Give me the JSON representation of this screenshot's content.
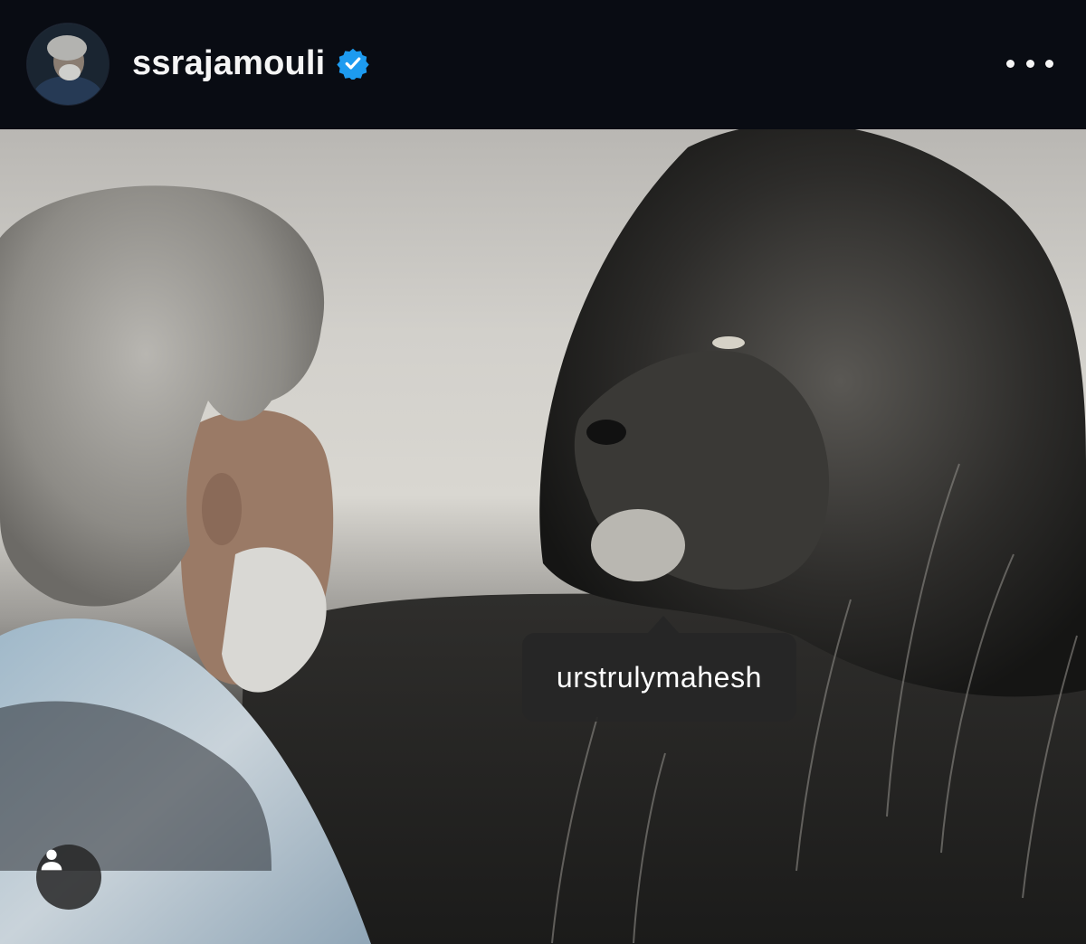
{
  "post_header": {
    "username": "ssrajamouli",
    "verified": true,
    "more_icon": "more-horizontal-icon",
    "verified_color": "#1d9bf0"
  },
  "photo": {
    "tagged_user": "urstrulymahesh",
    "tag_button_icon": "user-tag-icon",
    "tag_color": "#262626"
  }
}
